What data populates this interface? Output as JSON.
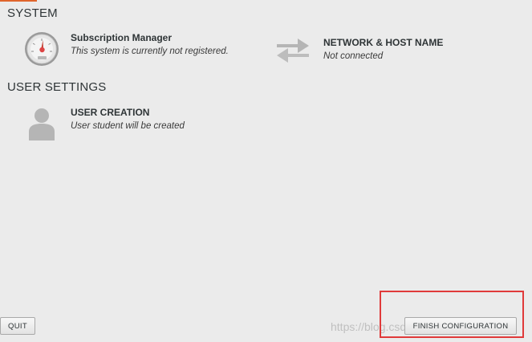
{
  "sections": {
    "system_title": "SYSTEM",
    "user_settings_title": "USER SETTINGS"
  },
  "spokes": {
    "subscription": {
      "title": "Subscription Manager",
      "status": "This system is currently not registered.",
      "icon": "gauge-icon"
    },
    "network": {
      "title": "NETWORK & HOST NAME",
      "status": "Not connected",
      "icon": "network-arrows-icon"
    },
    "user_creation": {
      "title": "USER CREATION",
      "status": "User student will be created",
      "icon": "user-icon"
    }
  },
  "buttons": {
    "quit": "QUIT",
    "finish": "FINISH CONFIGURATION"
  },
  "watermark": "https://blog.csdn.net/...",
  "colors": {
    "background": "#ebebeb",
    "accent": "#e0652c",
    "highlight": "#e03a3a",
    "icon_gray": "#b5b5b5"
  }
}
